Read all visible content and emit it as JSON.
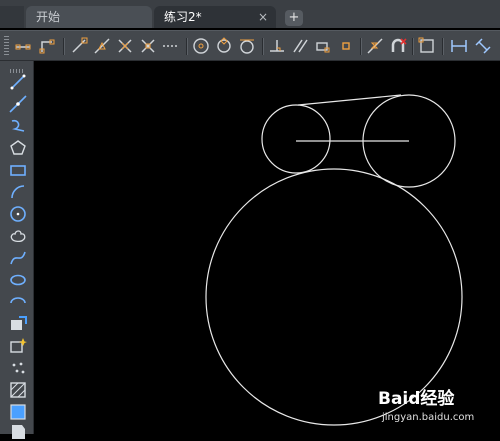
{
  "tabs": [
    {
      "label": "开始",
      "active": false
    },
    {
      "label": "练习2*",
      "active": true,
      "close": "×"
    }
  ],
  "new_tab_label": "+",
  "toolbar_icons": [
    "temporary-tracking-point-icon",
    "snap-from-icon",
    "endpoint-snap-icon",
    "midpoint-snap-icon",
    "intersection-snap-icon",
    "apparent-intersection-snap-icon",
    "extension-snap-icon",
    "center-snap-icon",
    "quadrant-snap-icon",
    "tangent-snap-icon",
    "perpendicular-snap-icon",
    "parallel-snap-icon",
    "insert-snap-icon",
    "node-snap-icon",
    "nearest-snap-icon",
    "none-snap-icon",
    "object-snap-settings-icon",
    "linear-dimension-icon",
    "aligned-dimension-icon"
  ],
  "left_toolbar_icons": [
    "line-icon",
    "construction-line-icon",
    "polyline-icon",
    "polygon-icon",
    "rectangle-icon",
    "arc-icon",
    "circle-icon",
    "revision-cloud-icon",
    "spline-icon",
    "ellipse-icon",
    "ellipse-arc-icon",
    "insert-block-icon",
    "make-block-icon",
    "point-icon",
    "hatch-icon",
    "gradient-icon",
    "region-icon"
  ],
  "watermark": {
    "logo": "Baid经验",
    "paw": "●",
    "url": "jingyan.baidu.com"
  },
  "colors": {
    "canvas": "#000000",
    "geometry": "#e8e8e8",
    "accent": "#2f6fe0"
  }
}
